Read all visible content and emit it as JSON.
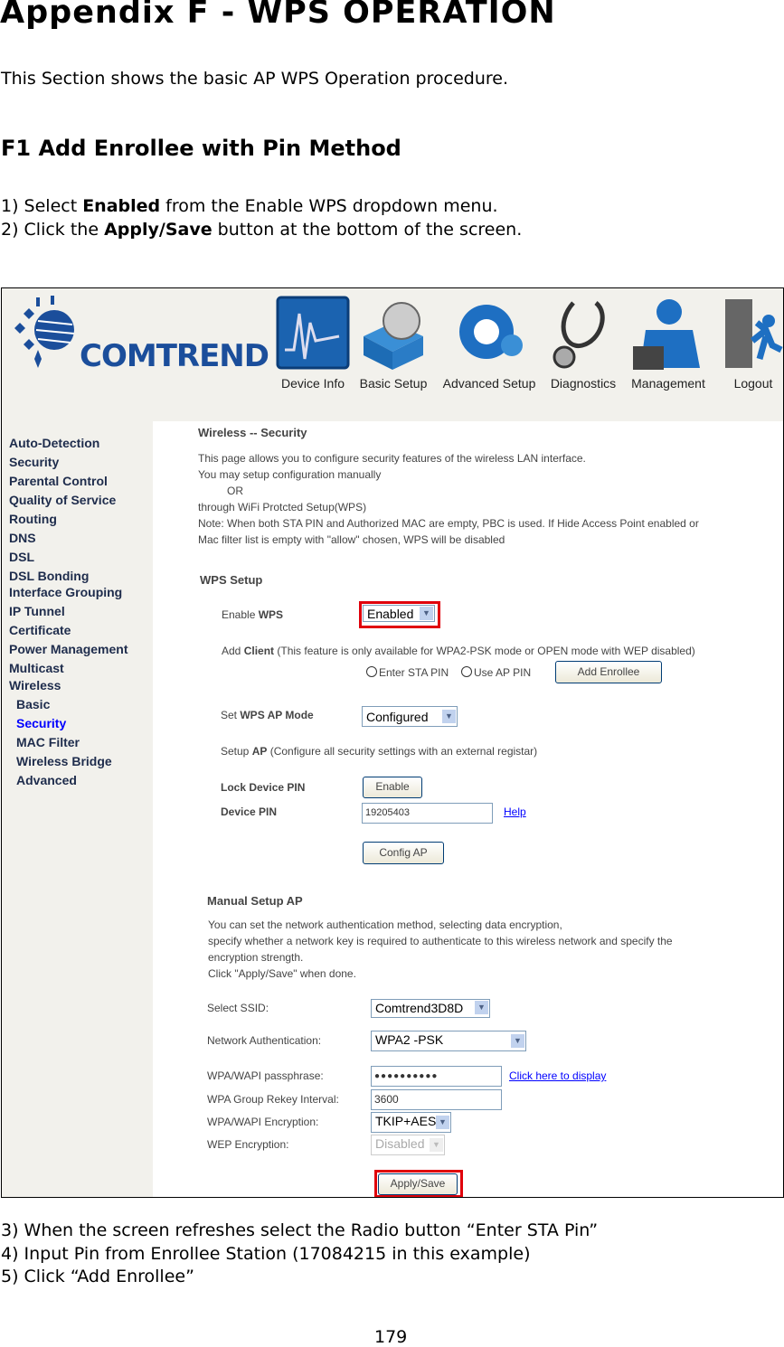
{
  "doc": {
    "title": "Appendix F - WPS OPERATION",
    "intro": "This Section shows the basic AP WPS Operation procedure.",
    "section": "F1 Add Enrollee with Pin Method",
    "step1": {
      "pre": "1) Select ",
      "bold": "Enabled",
      "post": " from the Enable WPS dropdown menu."
    },
    "step2": {
      "pre": "2) Click the ",
      "bold": "Apply/Save",
      "post": " button at the bottom of the screen."
    },
    "step3": "3) When the screen refreshes select the Radio button “Enter STA Pin”",
    "step4": "4) Input Pin from Enrollee Station (17084215 in this example)",
    "step5": "5) Click “Add Enrollee”",
    "page_number": "179"
  },
  "router": {
    "logo": "COMTREND",
    "nav": [
      {
        "label": "Device Info",
        "icon": "device-info-icon"
      },
      {
        "label": "Basic Setup",
        "icon": "basic-setup-icon"
      },
      {
        "label": "Advanced Setup",
        "icon": "gear-icon"
      },
      {
        "label": "Diagnostics",
        "icon": "stethoscope-icon"
      },
      {
        "label": "Management",
        "icon": "user-icon"
      },
      {
        "label": "Logout",
        "icon": "logout-icon"
      }
    ],
    "sidebar": [
      "Auto-Detection",
      "Security",
      "Parental Control",
      "Quality of Service",
      "Routing",
      "DNS",
      "DSL",
      "DSL Bonding",
      "Interface Grouping",
      "IP Tunnel",
      "Certificate",
      "Power Management",
      "Multicast",
      "Wireless"
    ],
    "sidebar_sub": [
      "Basic",
      "Security",
      "MAC Filter",
      "Wireless Bridge",
      "Advanced"
    ],
    "active_color": "#0000ff",
    "page_title": "Wireless -- Security",
    "desc": [
      "This page allows you to configure security features of the wireless LAN interface.",
      "You may setup configuration manually",
      "OR",
      "through WiFi Protcted Setup(WPS)",
      "Note: When both STA PIN and Authorized MAC are empty, PBC is used. If Hide Access Point enabled or",
      "Mac filter list is empty with \"allow\" chosen, WPS will be disabled"
    ],
    "wps": {
      "heading": "WPS Setup",
      "enable_label": "Enable ",
      "enable_bold": "WPS",
      "enable_value": "Enabled",
      "add_client_bold": "Client",
      "add_client_pre": "Add ",
      "add_client_note": " (This feature is only available for WPA2-PSK mode or OPEN mode with WEP disabled)",
      "radio_sta": "Enter STA PIN",
      "radio_ap": "Use AP PIN",
      "add_enrollee": "Add Enrollee",
      "mode_pre": "Set ",
      "mode_bold": "WPS AP Mode",
      "mode_value": "Configured",
      "setup_pre": "Setup ",
      "setup_bold": "AP",
      "setup_note": " (Configure all security settings with an external registar)",
      "lock_label": "Lock Device PIN",
      "lock_button": "Enable",
      "pin_label": "Device PIN",
      "pin_value": "19205403",
      "help": "Help",
      "config_ap": "Config AP"
    },
    "manual": {
      "heading": "Manual Setup AP",
      "desc": [
        "You can set the network authentication method, selecting data encryption,",
        "specify whether a network key is required to authenticate to this wireless network and specify the",
        "encryption strength.",
        "Click \"Apply/Save\" when done."
      ],
      "ssid_label": "Select SSID:",
      "ssid_value": "Comtrend3D8D",
      "auth_label": "Network Authentication:",
      "auth_value": "WPA2 -PSK",
      "pass_label": "WPA/WAPI passphrase:",
      "pass_value": "●●●●●●●●●●",
      "pass_link": "Click here to display",
      "rekey_label": "WPA Group Rekey Interval:",
      "rekey_value": "3600",
      "enc_label": "WPA/WAPI Encryption:",
      "enc_value": "TKIP+AES",
      "wep_label": "WEP Encryption:",
      "wep_value": "Disabled",
      "apply": "Apply/Save"
    },
    "highlight_color": "#e0000b"
  }
}
